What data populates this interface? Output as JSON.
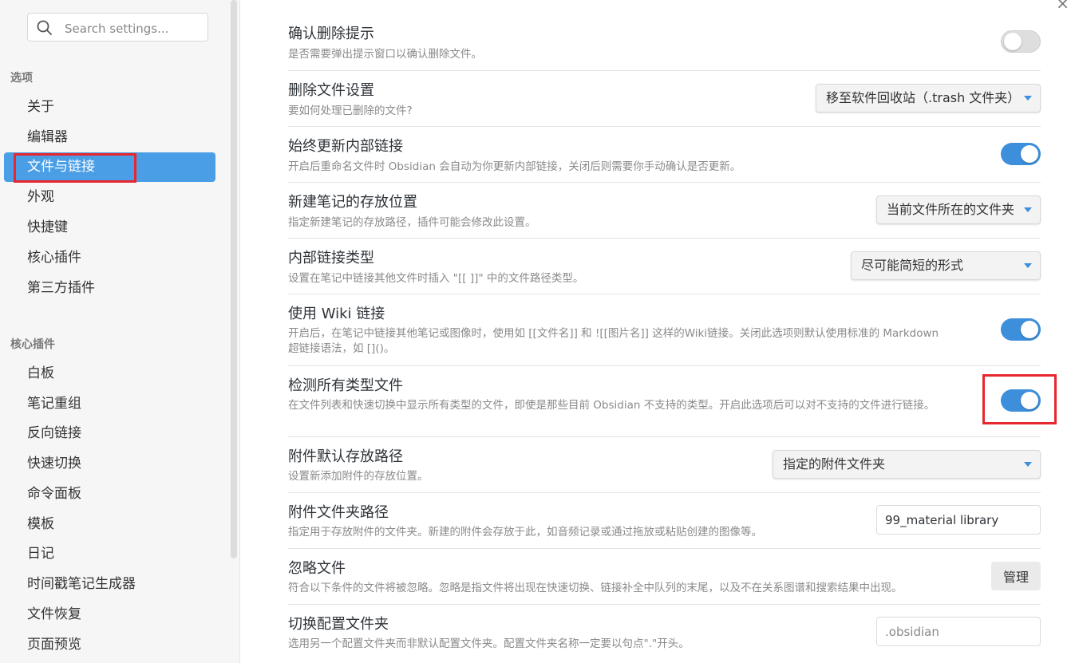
{
  "sidebar": {
    "search_placeholder": "Search settings...",
    "group1_title": "选项",
    "group1_items": [
      "关于",
      "编辑器",
      "文件与链接",
      "外观",
      "快捷键",
      "核心插件",
      "第三方插件"
    ],
    "group2_title": "核心插件",
    "group2_items": [
      "白板",
      "笔记重组",
      "反向链接",
      "快速切换",
      "命令面板",
      "模板",
      "日记",
      "时间戳笔记生成器",
      "文件恢复",
      "页面预览"
    ]
  },
  "settings": [
    {
      "name": "确认删除提示",
      "desc": "是否需要弹出提示窗口以确认删除文件。",
      "control": "toggle",
      "on": false
    },
    {
      "name": "删除文件设置",
      "desc": "要如何处理已删除的文件?",
      "control": "dropdown",
      "value": "移至软件回收站（.trash 文件夹）"
    },
    {
      "name": "始终更新内部链接",
      "desc": "开启后重命名文件时 Obsidian 会自动为你更新内部链接，关闭后则需要你手动确认是否更新。",
      "control": "toggle",
      "on": true
    },
    {
      "name": "新建笔记的存放位置",
      "desc": "指定新建笔记的存放路径，插件可能会修改此设置。",
      "control": "dropdown",
      "value": "当前文件所在的文件夹"
    },
    {
      "name": "内部链接类型",
      "desc": "设置在笔记中链接其他文件时插入 \"[[ ]]\" 中的文件路径类型。",
      "control": "dropdown",
      "value": "尽可能简短的形式"
    },
    {
      "name": "使用 Wiki 链接",
      "desc": "开启后，在笔记中链接其他笔记或图像时，使用如 [[文件名]] 和 ![[图片名]] 这样的Wiki链接。关闭此选项则默认使用标准的 Markdown 超链接语法，如 []()。",
      "control": "toggle",
      "on": true
    },
    {
      "name": "检测所有类型文件",
      "desc": "在文件列表和快速切换中显示所有类型的文件，即使是那些目前 Obsidian 不支持的类型。开启此选项后可以对不支持的文件进行链接。",
      "control": "toggle",
      "on": true
    },
    {
      "name": "附件默认存放路径",
      "desc": "设置新添加附件的存放位置。",
      "control": "dropdown",
      "value": "指定的附件文件夹"
    },
    {
      "name": "附件文件夹路径",
      "desc": "指定用于存放附件的文件夹。新建的附件会存放于此，如音频记录或通过拖放或粘贴创建的图像等。",
      "control": "text",
      "value": "99_material library"
    },
    {
      "name": "忽略文件",
      "desc": "符合以下条件的文件将被忽略。忽略是指文件将出现在快速切换、链接补全中队列的末尾，以及不在关系图谱和搜索结果中出现。",
      "control": "button",
      "label": "管理"
    },
    {
      "name": "切换配置文件夹",
      "desc": "选用另一个配置文件夹而非默认配置文件夹。配置文件夹名称一定要以句点\".\"开头。",
      "control": "text",
      "placeholder": ".obsidian"
    }
  ],
  "close_symbol": "×",
  "colors": {
    "accent": "#3d8fdc",
    "highlight_box": "#e8262d",
    "active_nav": "#4a9ee6"
  }
}
